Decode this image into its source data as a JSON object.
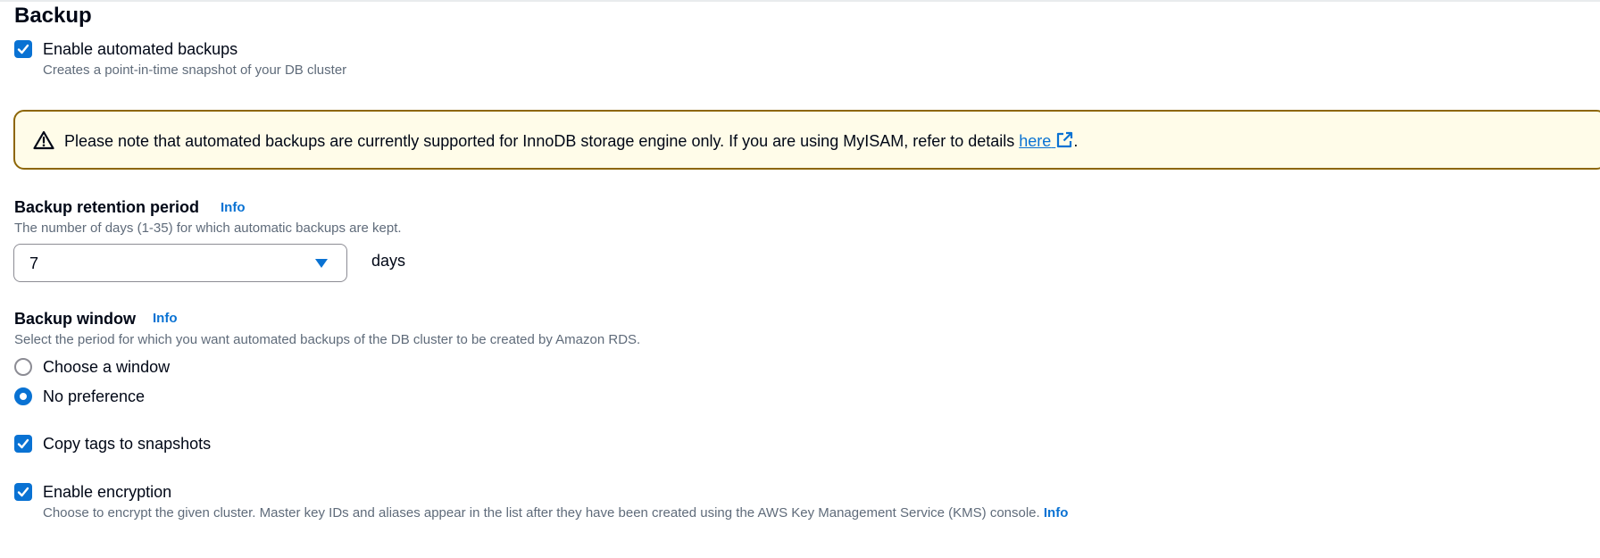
{
  "section": {
    "title": "Backup"
  },
  "automated_backups": {
    "label": "Enable automated backups",
    "checked": true,
    "description": "Creates a point-in-time snapshot of your DB cluster"
  },
  "alert": {
    "text": "Please note that automated backups are currently supported for InnoDB storage engine only. If you are using MyISAM, refer to details ",
    "link_text": "here",
    "suffix": "."
  },
  "retention": {
    "label": "Backup retention period",
    "info": "Info",
    "description": "The number of days (1-35) for which automatic backups are kept.",
    "value": "7",
    "unit": "days"
  },
  "backup_window": {
    "label": "Backup window",
    "info": "Info",
    "description": "Select the period for which you want automated backups of the DB cluster to be created by Amazon RDS.",
    "options": [
      {
        "label": "Choose a window",
        "selected": false
      },
      {
        "label": "No preference",
        "selected": true
      }
    ]
  },
  "copy_tags": {
    "label": "Copy tags to snapshots",
    "checked": true
  },
  "encryption": {
    "label": "Enable encryption",
    "checked": true,
    "description": "Choose to encrypt the given cluster. Master key IDs and aliases appear in the list after they have been created using the AWS Key Management Service (KMS) console.",
    "info": "Info"
  },
  "colors": {
    "accent": "#0972d3",
    "warning_border": "#8d6605",
    "warning_bg": "#fffce9"
  }
}
